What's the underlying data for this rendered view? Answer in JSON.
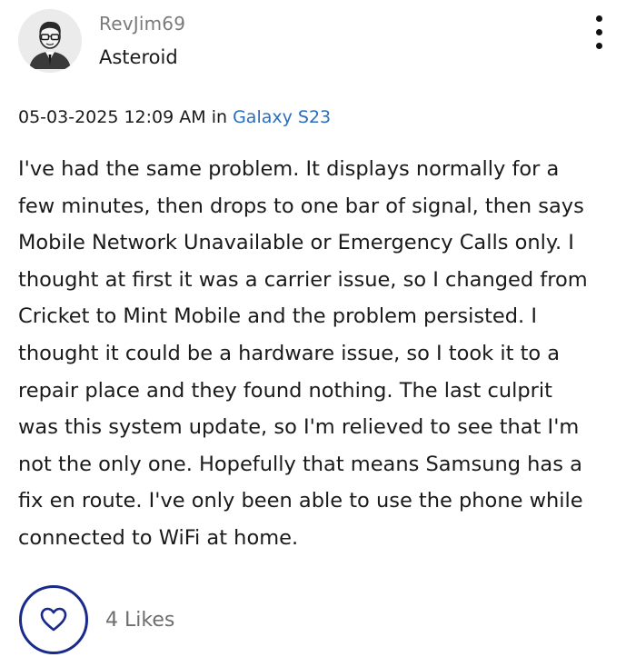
{
  "author": {
    "username": "RevJim69",
    "rank": "Asteroid",
    "avatar_icon": "user-avatar-icon"
  },
  "menu": {
    "icon": "more-vertical-icon"
  },
  "meta": {
    "timestamp": "05-03-2025 12:09 AM",
    "in_label": "in",
    "board": "Galaxy S23",
    "board_color": "#2a6ebb"
  },
  "body": {
    "lines": [
      "I've had the same problem. It displays normally for a",
      "few minutes, then drops to one bar of signal, then says",
      "Mobile Network Unavailable or Emergency Calls only. I",
      "thought at first it was a carrier issue, so I changed from",
      "Cricket to Mint Mobile and the problem persisted. I",
      "thought it could be a hardware issue, so I took it to a",
      "repair place and they found nothing. The last culprit",
      "was this system update, so I'm relieved to see that I'm",
      "not the only one. Hopefully that means Samsung has a",
      "fix en route. I've only been able to use the phone while",
      "connected to WiFi at home."
    ]
  },
  "likes": {
    "icon": "heart-icon",
    "count_label": "4 Likes",
    "button_color": "#1a2a8a"
  }
}
